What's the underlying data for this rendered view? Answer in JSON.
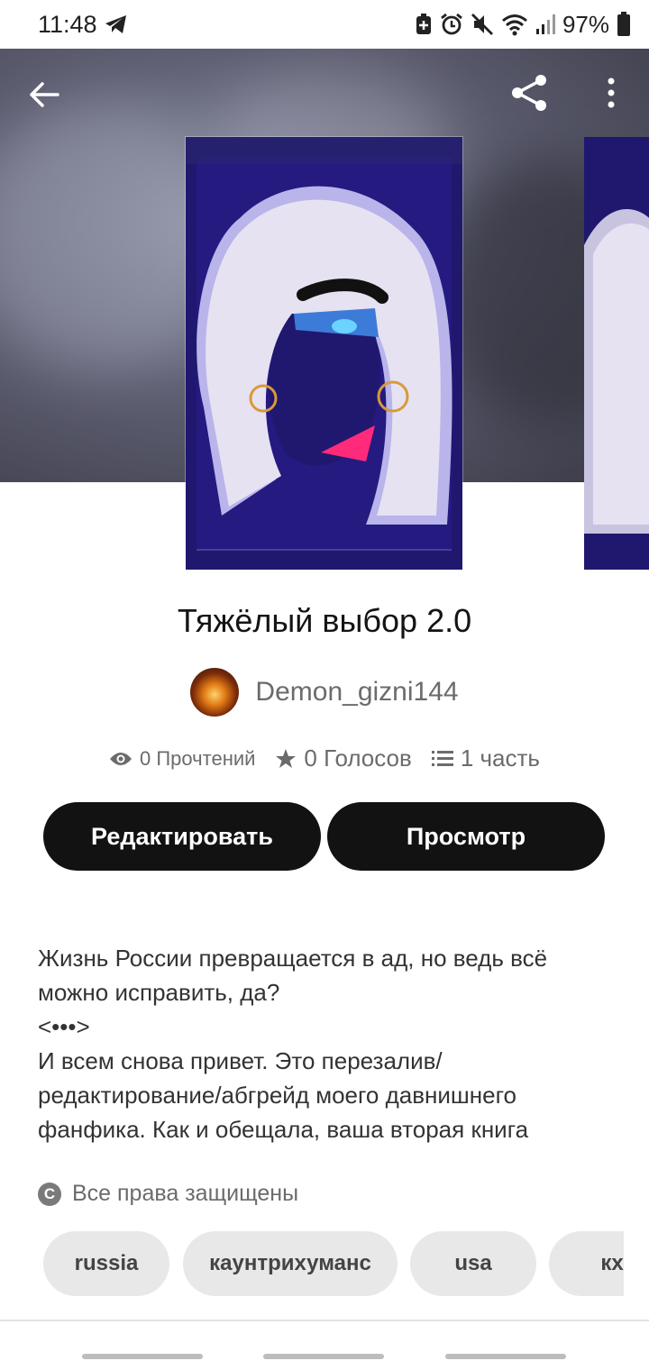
{
  "status_bar": {
    "time": "11:48",
    "battery": "97%",
    "icons": [
      "telegram-icon",
      "battery-saver-icon",
      "alarm-icon",
      "mute-icon",
      "wifi-icon",
      "signal-icon",
      "battery-icon"
    ]
  },
  "header": {
    "back_icon": "arrow-back-icon",
    "share_icon": "share-icon",
    "more_icon": "more-vertical-icon"
  },
  "story": {
    "title": "Тяжёлый выбор 2.0",
    "author": "Demon_gizni144",
    "stats": {
      "reads": "0 Прочтений",
      "votes": "0 Голосов",
      "parts": "1 часть"
    },
    "description": "Жизнь России превращается в ад, но ведь всё можно исправить, да?\n<•••>\nИ всем снова привет. Это перезалив/редактирование/абгрейд моего давнишнего фанфика. Как и обещала, ваша вторая книга",
    "copyright": "Все права защищены",
    "tags": [
      "russia",
      "каунтрихуманс",
      "usa",
      "кх"
    ]
  },
  "actions": {
    "edit_label": "Редактировать",
    "view_label": "Просмотр"
  },
  "colors": {
    "button_bg": "#121212",
    "button_text": "#ffffff",
    "tag_bg": "#e8e8e8",
    "cover_bg": "#1f1870"
  }
}
